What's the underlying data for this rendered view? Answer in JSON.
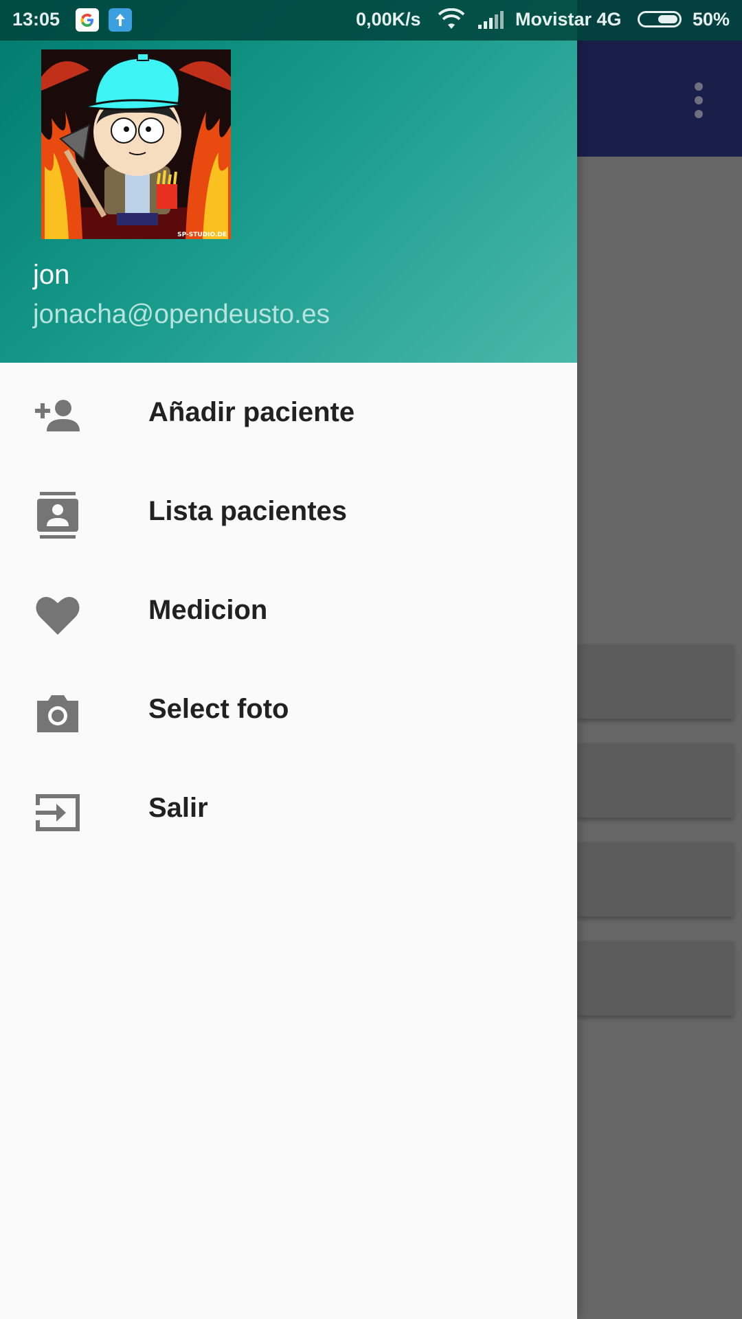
{
  "status_bar": {
    "time": "13:05",
    "net_speed": "0,00K/s",
    "carrier": "Movistar 4G",
    "battery_percent": "50%",
    "icons": [
      "google-icon",
      "upload-icon",
      "wifi-icon",
      "signal-icon",
      "battery-icon"
    ]
  },
  "drawer": {
    "header": {
      "user_name": "jon",
      "user_email": "jonacha@opendeusto.es",
      "avatar_watermark": "SP-STUDIO.DE"
    },
    "menu": [
      {
        "label": "Añadir paciente",
        "icon": "add-person-icon"
      },
      {
        "label": "Lista pacientes",
        "icon": "contacts-icon"
      },
      {
        "label": "Medicion",
        "icon": "heart-icon"
      },
      {
        "label": "Select foto",
        "icon": "camera-icon"
      },
      {
        "label": "Salir",
        "icon": "exit-icon"
      }
    ]
  },
  "colors": {
    "header_gradient_start": "#00796b",
    "header_gradient_end": "#4ab8ab",
    "toolbar": "#1a1f4a",
    "icon_gray": "#757575",
    "menu_text": "#212121",
    "scrim_content": "#666666"
  }
}
